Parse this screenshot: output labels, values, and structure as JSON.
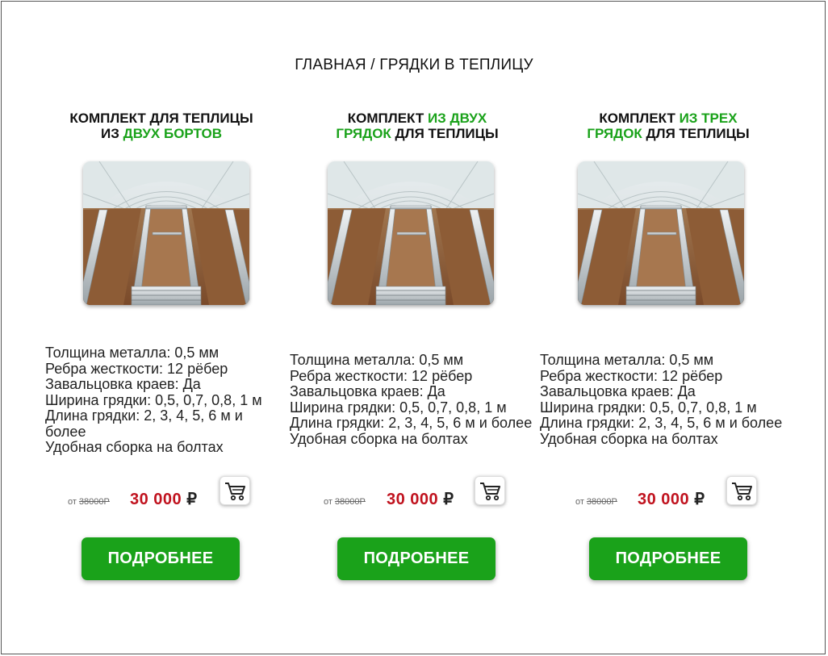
{
  "breadcrumb": "ГЛАВНАЯ / ГРЯДКИ В ТЕПЛИЦУ",
  "colors": {
    "accent_green": "#1aa21a",
    "price_red": "#c0121e"
  },
  "products": [
    {
      "title_line1_black": "КОМПЛЕКТ ДЛЯ ТЕПЛИЦЫ",
      "title_line2_black": "ИЗ ",
      "title_line2_green": "ДВУХ БОРТОВ",
      "specs": [
        "Толщина металла: 0,5 мм",
        "Ребра жесткости: 12 рёбер",
        "Завальцовка краев: Да",
        "Ширина грядки: 0,5, 0,7, 0,8, 1 м",
        "Длина грядки: 2, 3, 4, 5, 6 м и более",
        "Удобная сборка на болтах"
      ],
      "from_label": "от",
      "old_price": "38000Р",
      "price": "30 000",
      "currency": "₽",
      "cart_icon": "cart-icon",
      "button_label": "ПОДРОБНЕЕ"
    },
    {
      "title_line1_black": "КОМПЛЕКТ ",
      "title_line1_green": "ИЗ ДВУХ",
      "title_line2_green": "ГРЯДОК",
      "title_line2_black": " ДЛЯ ТЕПЛИЦЫ",
      "specs": [
        "Толщина металла: 0,5 мм",
        "Ребра жесткости: 12 рёбер",
        "Завальцовка краев: Да",
        "Ширина грядки: 0,5, 0,7, 0,8, 1 м",
        "Длина грядки: 2, 3, 4, 5, 6 м и более",
        "Удобная сборка на болтах"
      ],
      "from_label": "от",
      "old_price": "38000Р",
      "price": "30 000",
      "currency": "₽",
      "cart_icon": "cart-icon",
      "button_label": "ПОДРОБНЕЕ"
    },
    {
      "title_line1_black": "КОМПЛЕКТ ",
      "title_line1_green": "ИЗ ТРЕХ",
      "title_line2_green": "ГРЯДОК",
      "title_line2_black": " ДЛЯ ТЕПЛИЦЫ",
      "specs": [
        "Толщина металла: 0,5 мм",
        "Ребра жесткости: 12 рёбер",
        "Завальцовка краев: Да",
        "Ширина грядки: 0,5, 0,7, 0,8, 1 м",
        "Длина грядки: 2, 3, 4, 5, 6 м и более",
        "Удобная сборка на болтах"
      ],
      "from_label": "от",
      "old_price": "38000Р",
      "price": "30 000",
      "currency": "₽",
      "cart_icon": "cart-icon",
      "button_label": "ПОДРОБНЕЕ"
    }
  ]
}
